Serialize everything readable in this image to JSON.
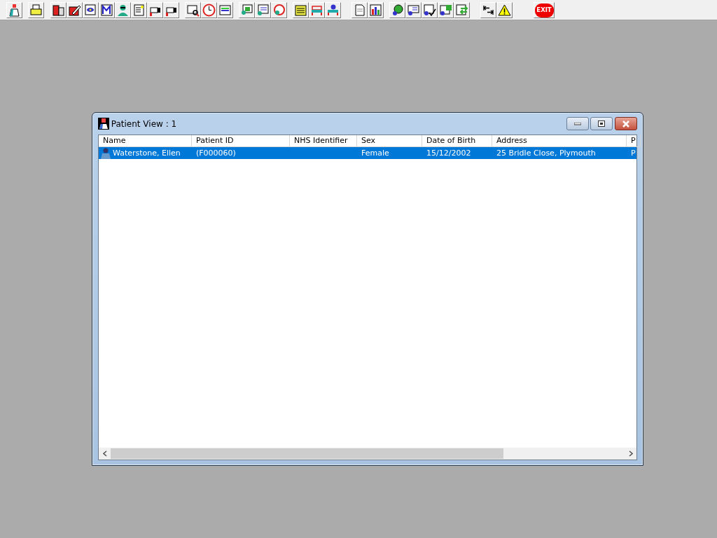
{
  "toolbar": {
    "exit_label": "EXIT"
  },
  "window": {
    "title": "Patient View : 1"
  },
  "table": {
    "columns": [
      "Name",
      "Patient ID",
      "NHS Identifier",
      "Sex",
      "Date of Birth",
      "Address",
      "P"
    ],
    "rows": [
      {
        "selected": true,
        "cells": [
          "Waterstone, Ellen",
          "(F000060)",
          "",
          "Female",
          "15/12/2002",
          "25 Bridle Close, Plymouth",
          "P"
        ]
      }
    ]
  }
}
